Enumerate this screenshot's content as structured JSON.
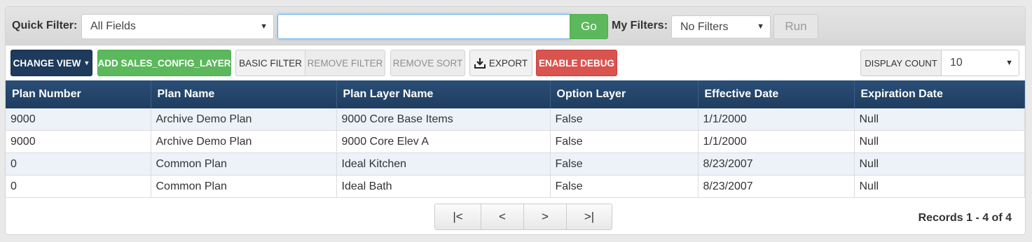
{
  "filter_bar": {
    "quick_filter_label": "Quick Filter:",
    "quick_filter_field": "All Fields",
    "search_value": "",
    "go_label": "Go",
    "my_filters_label": "My Filters:",
    "my_filters_value": "No Filters",
    "run_label": "Run"
  },
  "toolbar": {
    "change_view_label": "CHANGE VIEW",
    "add_label": "ADD SALES_CONFIG_LAYER",
    "basic_filter_label": "BASIC FILTER",
    "remove_filter_label": "REMOVE FILTER",
    "remove_sort_label": "REMOVE SORT",
    "export_label": "EXPORT",
    "enable_debug_label": "ENABLE DEBUG",
    "display_count_label": "DISPLAY COUNT",
    "display_count_value": "10"
  },
  "table": {
    "columns": [
      "Plan Number",
      "Plan Name",
      "Plan Layer Name",
      "Option Layer",
      "Effective Date",
      "Expiration Date"
    ],
    "rows": [
      [
        "9000",
        "Archive Demo Plan",
        "9000 Core Base Items",
        "False",
        "1/1/2000",
        "Null"
      ],
      [
        "9000",
        "Archive Demo Plan",
        "9000 Core Elev A",
        "False",
        "1/1/2000",
        "Null"
      ],
      [
        "0",
        "Common Plan",
        "Ideal Kitchen",
        "False",
        "8/23/2007",
        "Null"
      ],
      [
        "0",
        "Common Plan",
        "Ideal Bath",
        "False",
        "8/23/2007",
        "Null"
      ]
    ]
  },
  "pager": {
    "first": "|<",
    "prev": "<",
    "next": ">",
    "last": ">|",
    "records_text": "Records 1 - 4 of 4"
  },
  "colors": {
    "header_navy": "#1f3d5f",
    "success_green": "#5cb85c",
    "danger_red": "#d9534f",
    "dark_button": "#1e3a5c"
  }
}
